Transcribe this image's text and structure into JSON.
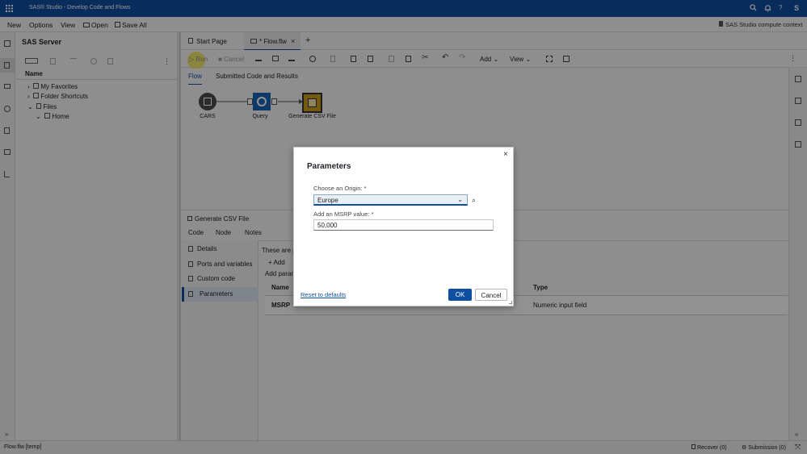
{
  "app": {
    "title": "SAS® Studio - Develop Code and Flows",
    "user_initial": "S"
  },
  "menu": {
    "new": "New",
    "options": "Options",
    "view": "View",
    "open": "Open",
    "save_all": "Save All",
    "context": "SAS Studio compute context"
  },
  "left_panel": {
    "title": "SAS Server",
    "column_header": "Name",
    "tree": [
      {
        "label": "My Favorites"
      },
      {
        "label": "Folder Shortcuts"
      },
      {
        "label": "Files"
      },
      {
        "label": "Home"
      }
    ]
  },
  "tabs": {
    "start_page": "Start Page",
    "flow": "* Flow.flw",
    "add": "+"
  },
  "toolbar": {
    "run": "Run",
    "cancel": "Cancel",
    "add": "Add",
    "view": "View"
  },
  "subtabs": {
    "flow": "Flow",
    "submitted": "Submitted Code and Results"
  },
  "flow_nodes": [
    {
      "label": "CARS"
    },
    {
      "label": "Query"
    },
    {
      "label": "Generate CSV File"
    }
  ],
  "bottom_panel": {
    "title": "Generate CSV File",
    "tabs": [
      "Code",
      "Node",
      "Notes"
    ],
    "sidebar": [
      "Details",
      "Ports and variables",
      "Custom code",
      "Parameters"
    ],
    "intro": "These are p",
    "add_label": "Add",
    "add_param": "Add param",
    "columns": {
      "name": "Name",
      "type": "Type"
    },
    "row": {
      "name": "MSRP",
      "type": "Numeric input field"
    }
  },
  "status": {
    "left": "Flow.flw [temp]",
    "recover": "Recover (0)",
    "submission": "Submission (0)"
  },
  "dialog": {
    "title": "Parameters",
    "origin_label": "Choose an Origin: *",
    "origin_value": "Europe",
    "msrp_label": "Add an MSRP value: *",
    "msrp_value": "50,000",
    "reset": "Reset to defaults",
    "ok": "OK",
    "cancel": "Cancel"
  },
  "colors": {
    "brand": "#0f4fa0",
    "node_dark": "#4a4a4a",
    "node_query": "#1a62b3",
    "node_csv": "#c99a1c"
  }
}
